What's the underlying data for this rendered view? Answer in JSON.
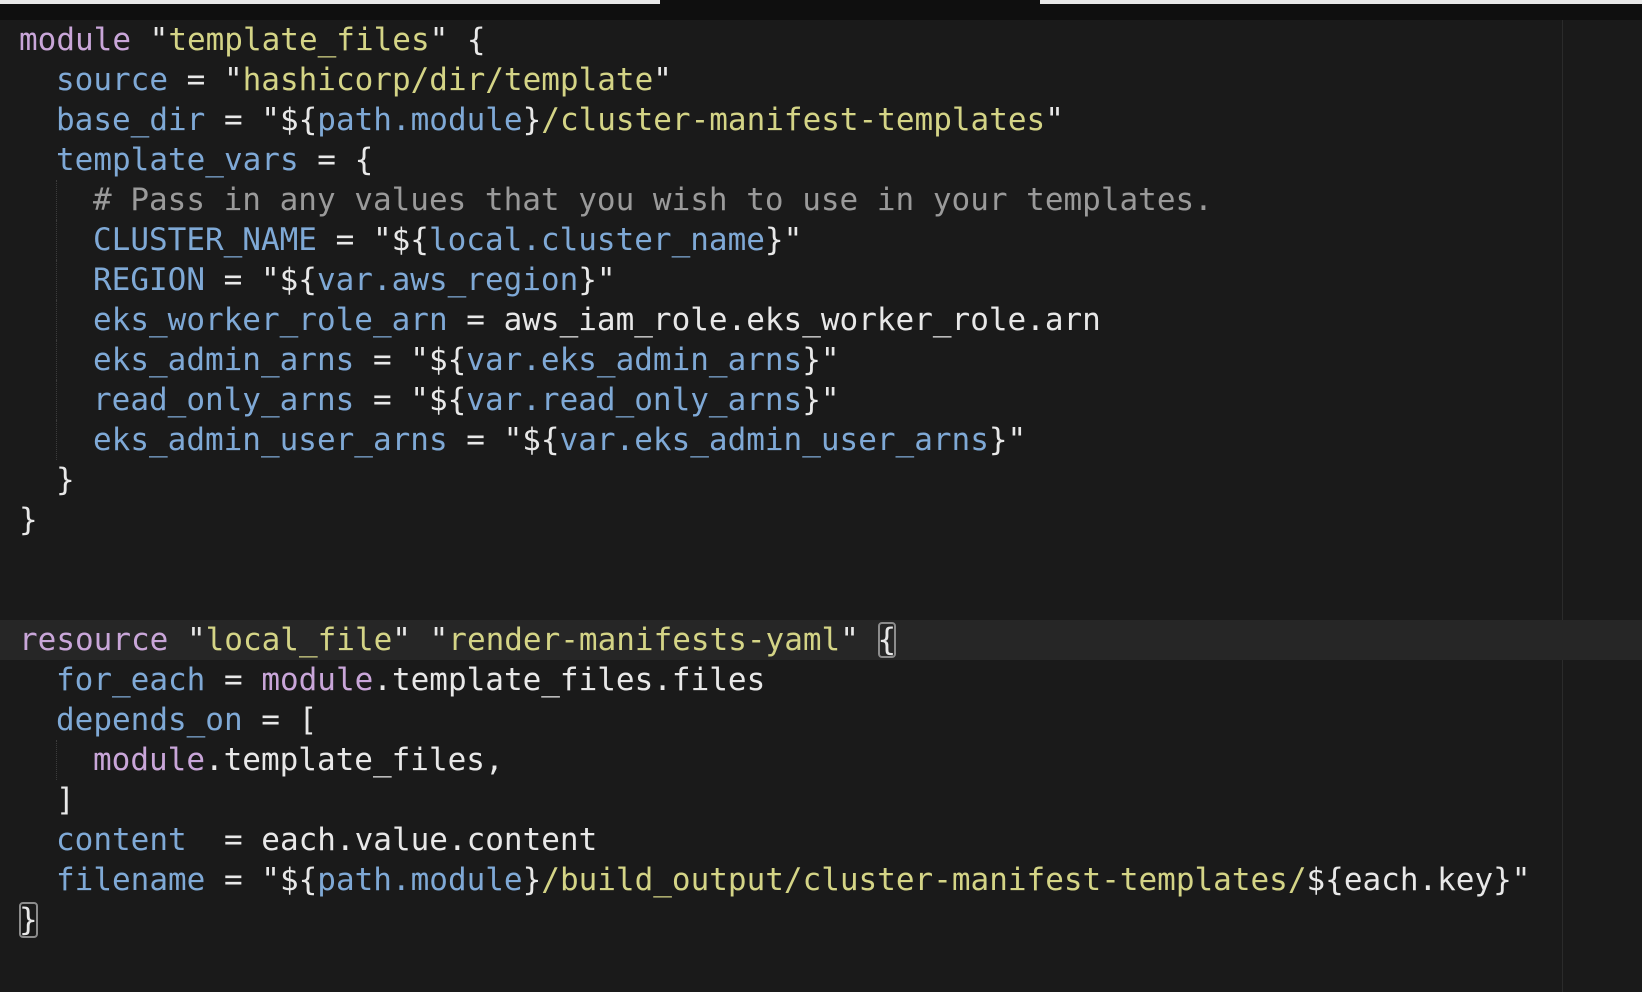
{
  "editor": {
    "lines": [
      {
        "indent": 0,
        "guide": false,
        "current": false,
        "tokens": [
          {
            "t": "module",
            "c": "kw"
          },
          {
            "t": " \"",
            "c": "pl"
          },
          {
            "t": "template_files",
            "c": "str"
          },
          {
            "t": "\" {",
            "c": "pl"
          }
        ]
      },
      {
        "indent": 1,
        "guide": false,
        "current": false,
        "tokens": [
          {
            "t": "source",
            "c": "attr"
          },
          {
            "t": " = \"",
            "c": "pl"
          },
          {
            "t": "hashicorp/dir/template",
            "c": "str"
          },
          {
            "t": "\"",
            "c": "pl"
          }
        ]
      },
      {
        "indent": 1,
        "guide": false,
        "current": false,
        "tokens": [
          {
            "t": "base_dir",
            "c": "attr"
          },
          {
            "t": " = \"${",
            "c": "pl"
          },
          {
            "t": "path.module",
            "c": "attr"
          },
          {
            "t": "}",
            "c": "pl"
          },
          {
            "t": "/cluster-manifest-templates",
            "c": "str"
          },
          {
            "t": "\"",
            "c": "pl"
          }
        ]
      },
      {
        "indent": 1,
        "guide": false,
        "current": false,
        "tokens": [
          {
            "t": "template_vars",
            "c": "attr"
          },
          {
            "t": " = {",
            "c": "pl"
          }
        ]
      },
      {
        "indent": 2,
        "guide": true,
        "current": false,
        "tokens": [
          {
            "t": "# Pass in any values that you wish to use in your templates.",
            "c": "cmt"
          }
        ]
      },
      {
        "indent": 2,
        "guide": true,
        "current": false,
        "tokens": [
          {
            "t": "CLUSTER_NAME",
            "c": "attr"
          },
          {
            "t": " = \"${",
            "c": "pl"
          },
          {
            "t": "local.cluster_name",
            "c": "attr"
          },
          {
            "t": "}\"",
            "c": "pl"
          }
        ]
      },
      {
        "indent": 2,
        "guide": true,
        "current": false,
        "tokens": [
          {
            "t": "REGION",
            "c": "attr"
          },
          {
            "t": " = \"${",
            "c": "pl"
          },
          {
            "t": "var.aws_region",
            "c": "attr"
          },
          {
            "t": "}\"",
            "c": "pl"
          }
        ]
      },
      {
        "indent": 2,
        "guide": true,
        "current": false,
        "tokens": [
          {
            "t": "eks_worker_role_arn",
            "c": "attr"
          },
          {
            "t": " = aws_iam_role.eks_worker_role.arn",
            "c": "pl"
          }
        ]
      },
      {
        "indent": 2,
        "guide": true,
        "current": false,
        "tokens": [
          {
            "t": "eks_admin_arns",
            "c": "attr"
          },
          {
            "t": " = \"${",
            "c": "pl"
          },
          {
            "t": "var.eks_admin_arns",
            "c": "attr"
          },
          {
            "t": "}\"",
            "c": "pl"
          }
        ]
      },
      {
        "indent": 2,
        "guide": true,
        "current": false,
        "tokens": [
          {
            "t": "read_only_arns",
            "c": "attr"
          },
          {
            "t": " = \"${",
            "c": "pl"
          },
          {
            "t": "var.read_only_arns",
            "c": "attr"
          },
          {
            "t": "}\"",
            "c": "pl"
          }
        ]
      },
      {
        "indent": 2,
        "guide": true,
        "current": false,
        "tokens": [
          {
            "t": "eks_admin_user_arns",
            "c": "attr"
          },
          {
            "t": " = \"${",
            "c": "pl"
          },
          {
            "t": "var.eks_admin_user_arns",
            "c": "attr"
          },
          {
            "t": "}\"",
            "c": "pl"
          }
        ]
      },
      {
        "indent": 1,
        "guide": false,
        "current": false,
        "tokens": [
          {
            "t": "}",
            "c": "pl"
          }
        ]
      },
      {
        "indent": 0,
        "guide": false,
        "current": false,
        "tokens": [
          {
            "t": "}",
            "c": "pl"
          }
        ]
      },
      {
        "indent": 0,
        "guide": false,
        "current": false,
        "tokens": []
      },
      {
        "indent": 0,
        "guide": false,
        "current": false,
        "tokens": []
      },
      {
        "indent": 0,
        "guide": false,
        "current": true,
        "tokens": [
          {
            "t": "resource",
            "c": "kw"
          },
          {
            "t": " \"",
            "c": "pl"
          },
          {
            "t": "local_file",
            "c": "str"
          },
          {
            "t": "\" \"",
            "c": "pl"
          },
          {
            "t": "render-manifests-yaml",
            "c": "str"
          },
          {
            "t": "\" ",
            "c": "pl"
          },
          {
            "t": "{",
            "c": "pl",
            "m": true
          }
        ]
      },
      {
        "indent": 1,
        "guide": false,
        "current": false,
        "tokens": [
          {
            "t": "for_each",
            "c": "attr"
          },
          {
            "t": " = ",
            "c": "pl"
          },
          {
            "t": "module",
            "c": "kw"
          },
          {
            "t": ".template_files.files",
            "c": "pl"
          }
        ]
      },
      {
        "indent": 1,
        "guide": false,
        "current": false,
        "tokens": [
          {
            "t": "depends_on",
            "c": "attr"
          },
          {
            "t": " = [",
            "c": "pl"
          }
        ]
      },
      {
        "indent": 2,
        "guide": true,
        "current": false,
        "tokens": [
          {
            "t": "module",
            "c": "kw"
          },
          {
            "t": ".template_files,",
            "c": "pl"
          }
        ]
      },
      {
        "indent": 1,
        "guide": false,
        "current": false,
        "tokens": [
          {
            "t": "]",
            "c": "pl"
          }
        ]
      },
      {
        "indent": 1,
        "guide": false,
        "current": false,
        "tokens": [
          {
            "t": "content",
            "c": "attr"
          },
          {
            "t": "  = each.value.content",
            "c": "pl"
          }
        ]
      },
      {
        "indent": 1,
        "guide": false,
        "current": false,
        "tokens": [
          {
            "t": "filename",
            "c": "attr"
          },
          {
            "t": " = \"${",
            "c": "pl"
          },
          {
            "t": "path.module",
            "c": "attr"
          },
          {
            "t": "}",
            "c": "pl"
          },
          {
            "t": "/build_output/cluster-manifest-templates/",
            "c": "str"
          },
          {
            "t": "${each.key}\"",
            "c": "pl"
          }
        ]
      },
      {
        "indent": 0,
        "guide": false,
        "current": false,
        "tokens": [
          {
            "t": "}",
            "c": "pl",
            "m": true
          }
        ]
      }
    ]
  }
}
